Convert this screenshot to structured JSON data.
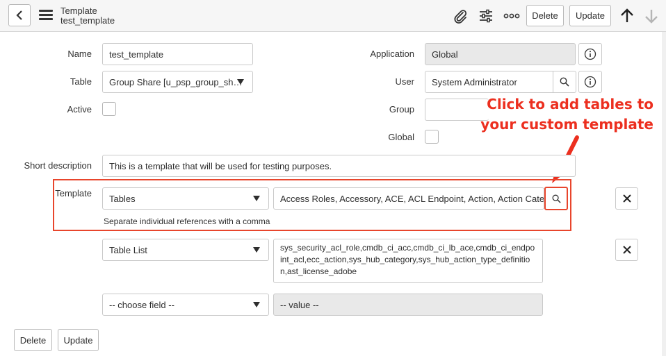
{
  "header": {
    "table_name": "Template",
    "record_name": "test_template",
    "delete_label": "Delete",
    "update_label": "Update",
    "icons": [
      "back-icon",
      "menu-icon",
      "attachment-icon",
      "settings-sliders-icon",
      "more-icon",
      "arrow-up-icon",
      "arrow-down-icon"
    ]
  },
  "form": {
    "name": {
      "label": "Name",
      "value": "test_template"
    },
    "table": {
      "label": "Table",
      "value": "Group Share [u_psp_group_sh…"
    },
    "active": {
      "label": "Active",
      "checked": false
    },
    "application": {
      "label": "Application",
      "value": "Global"
    },
    "user": {
      "label": "User",
      "value": "System Administrator"
    },
    "group": {
      "label": "Group",
      "value": ""
    },
    "global": {
      "label": "Global",
      "checked": false
    },
    "short_description": {
      "label": "Short description",
      "value": "This is a template that will be used for testing purposes."
    },
    "template": {
      "label": "Template",
      "row1": {
        "field": "Tables",
        "value": "Access Roles, Accessory, ACE, ACL Endpoint, Action, Action Category,",
        "hint": "Separate individual references with a comma"
      },
      "row2": {
        "field": "Table List",
        "value": "sys_security_acl_role,cmdb_ci_acc,cmdb_ci_lb_ace,cmdb_ci_endpoint_acl,ecc_action,sys_hub_category,sys_hub_action_type_definition,ast_license_adobe"
      },
      "row3": {
        "field": "-- choose field --",
        "value": "-- value --"
      }
    }
  },
  "callout": {
    "line1": "Click to add tables to",
    "line2": "your custom template",
    "color": "#ec2f1f"
  },
  "footer": {
    "delete_label": "Delete",
    "update_label": "Update"
  }
}
